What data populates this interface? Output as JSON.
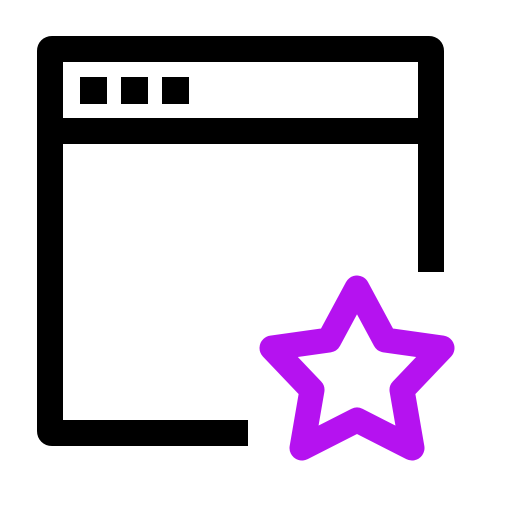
{
  "icon": {
    "name": "favorite-window-icon",
    "parts": [
      "browser-window-icon",
      "star-icon"
    ]
  },
  "colors": {
    "window_stroke": "#000000",
    "star_stroke": "#B512F0",
    "background": "#FFFFFF"
  }
}
